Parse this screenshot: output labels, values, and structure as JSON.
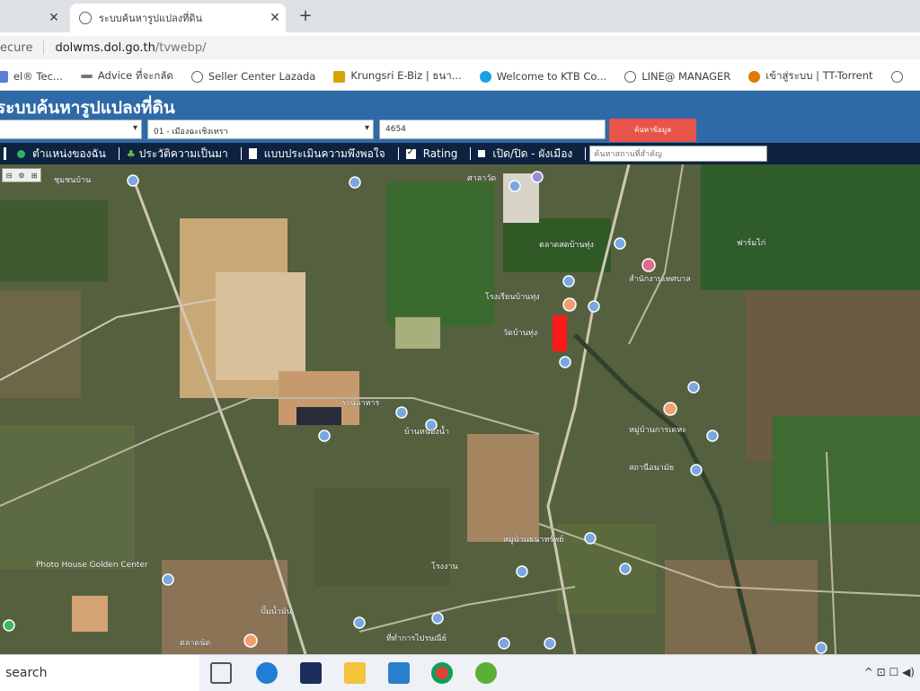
{
  "browser": {
    "tabs": [
      {
        "title": "",
        "close": "✕"
      },
      {
        "title": "ระบบค้นหารูปแปลงที่ดิน",
        "close": "✕"
      }
    ],
    "new_tab": "+",
    "address": {
      "secure": "ecure",
      "host": "dolwms.dol.go.th",
      "path": "/tvwebp/"
    },
    "bookmarks": [
      {
        "label": "el® Tec...",
        "icon": "bookmark-icon",
        "color": "#5b7fd6"
      },
      {
        "label": "Advice ที่จะกลัด",
        "icon": "advice-icon",
        "color": "#777777"
      },
      {
        "label": "Seller Center Lazada",
        "icon": "globe-icon",
        "color": "#5f6368"
      },
      {
        "label": "Krungsri E-Biz | ธนา...",
        "icon": "krungsri-icon",
        "color": "#d6a300"
      },
      {
        "label": "Welcome to KTB Co...",
        "icon": "ktb-icon",
        "color": "#1ba1e2"
      },
      {
        "label": "LINE@ MANAGER",
        "icon": "globe-icon",
        "color": "#5f6368"
      },
      {
        "label": "เข้าสู่ระบบ | TT-Torrent",
        "icon": "torrent-icon",
        "color": "#e07b00"
      },
      {
        "label": "",
        "icon": "globe-icon",
        "color": "#5f6368"
      }
    ]
  },
  "site": {
    "title": "ระบบค้นหารูปแปลงที่ดิน",
    "province_select": "",
    "amphoe_select": "01 - เมืองฉะเชิงเทรา",
    "parcel_input": "4654",
    "search_button": "ค้นหาข้อมูล",
    "layers": [
      {
        "label": "ตำแหน่งของฉัน",
        "type": "dot",
        "color": "#2fb26b"
      },
      {
        "label": "ประวัติความเป็นมา",
        "type": "plant",
        "color": "#6cc24a"
      },
      {
        "label": "แบบประเมินความพึงพอใจ",
        "type": "doc",
        "color": "#ffffff"
      },
      {
        "label": "Rating",
        "type": "check",
        "checked": true
      },
      {
        "label": "เปิด/ปิด - ผังเมือง",
        "type": "check",
        "checked": false
      }
    ],
    "place_placeholder": "ค้นหาสถานที่สำคัญ"
  },
  "map": {
    "ctrl": [
      "⊟",
      "⚙",
      "⊞"
    ],
    "labels": [
      "ชุมชนบ้าน",
      "ศาลาวัด",
      "ตลาดสดบ้านทุ่ง",
      "สำนักงานเทศบาล",
      "โรงเรียนบ้านทุ่ง",
      "วัดบ้านทุ่ง",
      "หมู่บ้านการเคหะ",
      "ร้านอาหาร",
      "บ้านหนองน้ำ",
      "สถานีอนามัย",
      "Photo House Golden Center",
      "หมู่บ้านธนาทรัพย์",
      "โรงงาน",
      "ปั๊มน้ำมัน",
      "ที่ทำการไปรษณีย์",
      "ฟาร์มไก่",
      "ตลาดนัด"
    ]
  },
  "taskbar": {
    "search": "search",
    "apps": [
      {
        "name": "task-view-icon",
        "color": "#555555"
      },
      {
        "name": "edge-icon",
        "color": "#1f7fd6"
      },
      {
        "name": "photoshop-icon",
        "color": "#1c2f5a"
      },
      {
        "name": "file-explorer-icon",
        "color": "#f3c33b"
      },
      {
        "name": "mail-icon",
        "color": "#2a7fd0"
      },
      {
        "name": "chrome-icon",
        "color": "#db4437"
      },
      {
        "name": "utorrent-icon",
        "color": "#5ab033"
      }
    ],
    "tray": "^ ⊡ ☐ ◀)"
  }
}
